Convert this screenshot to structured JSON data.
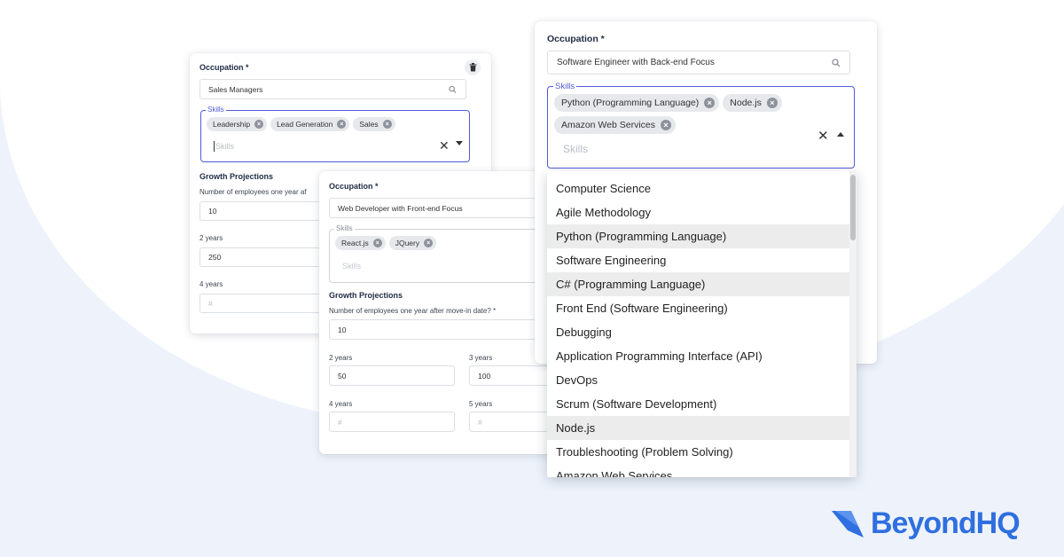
{
  "colors": {
    "accent": "#4f5bd5",
    "brand": "#2f6fe0",
    "chip_bg": "#e6e8ec"
  },
  "card_left": {
    "occupation_label": "Occupation *",
    "occupation_value": "Sales Managers",
    "skills_legend": "Skills",
    "chips": [
      "Leadership",
      "Lead Generation",
      "Sales"
    ],
    "skills_placeholder": "Skills",
    "growth_title": "Growth Projections",
    "employees_label": "Number of employees one year af",
    "employees_value": "10",
    "years2_label": "2 years",
    "years2_value": "250",
    "years4_label": "4 years",
    "years4_placeholder": "#",
    "delete_icon": "trash-icon"
  },
  "card_mid": {
    "occupation_label": "Occupation *",
    "occupation_value": "Web Developer with Front-end Focus",
    "skills_legend": "Skills",
    "chips": [
      "React.js",
      "JQuery"
    ],
    "skills_placeholder": "Skills",
    "growth_title": "Growth Projections",
    "employees_label": "Number of employees one year after move-in date? *",
    "employees_value": "10",
    "years2_label": "2 years",
    "years2_value": "50",
    "years3_label": "3 years",
    "years3_value": "100",
    "years4_label": "4 years",
    "years4_placeholder": "#",
    "years5_label": "5 years",
    "years5_placeholder": "#"
  },
  "card_right": {
    "occupation_label": "Occupation *",
    "occupation_value": "Software Engineer with Back-end Focus",
    "skills_legend": "Skills",
    "chips": [
      "Python (Programming Language)",
      "Node.js",
      "Amazon Web Services"
    ],
    "skills_placeholder": "Skills",
    "dropdown_items": [
      "Computer Science",
      "Agile Methodology",
      "Python (Programming Language)",
      "Software Engineering",
      "C# (Programming Language)",
      "Front End (Software Engineering)",
      "Debugging",
      "Application Programming Interface (API)",
      "DevOps",
      "Scrum (Software Development)",
      "Node.js",
      "Troubleshooting (Problem Solving)",
      "Amazon Web Services"
    ],
    "highlighted": [
      false,
      false,
      true,
      false,
      true,
      false,
      false,
      false,
      false,
      false,
      true,
      false,
      false
    ]
  },
  "brand": {
    "name": "BeyondHQ"
  }
}
